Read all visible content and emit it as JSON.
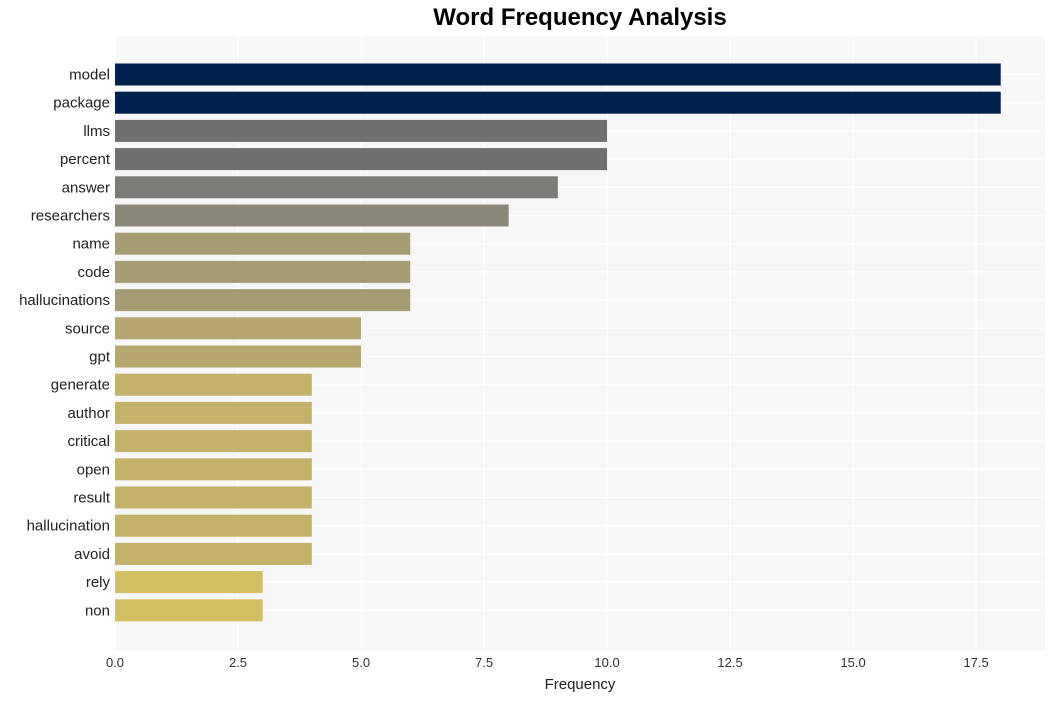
{
  "chart_data": {
    "type": "bar",
    "orientation": "horizontal",
    "title": "Word Frequency Analysis",
    "xlabel": "Frequency",
    "ylabel": "",
    "xlim": [
      0,
      18.9
    ],
    "xticks": [
      "0.0",
      "2.5",
      "5.0",
      "7.5",
      "10.0",
      "12.5",
      "15.0",
      "17.5"
    ],
    "xtick_values": [
      0,
      2.5,
      5,
      7.5,
      10,
      12.5,
      15,
      17.5
    ],
    "grid": true,
    "categories": [
      "model",
      "package",
      "llms",
      "percent",
      "answer",
      "researchers",
      "name",
      "code",
      "hallucinations",
      "source",
      "gpt",
      "generate",
      "author",
      "critical",
      "open",
      "result",
      "hallucination",
      "avoid",
      "rely",
      "non"
    ],
    "values": [
      18,
      18,
      10,
      10,
      9,
      8,
      6,
      6,
      6,
      5,
      5,
      4,
      4,
      4,
      4,
      4,
      4,
      4,
      3,
      3
    ],
    "colors": [
      "#00204e",
      "#00204e",
      "#6f6f72",
      "#6f6f72",
      "#7c7b78",
      "#8b8879",
      "#a59c74",
      "#a59c74",
      "#a59c74",
      "#b5a76f",
      "#b5a76f",
      "#c4b26a",
      "#c4b26a",
      "#c4b26a",
      "#c4b26a",
      "#c4b26a",
      "#c4b26a",
      "#c4b26a",
      "#d3bf5f",
      "#d3bf5f"
    ]
  }
}
